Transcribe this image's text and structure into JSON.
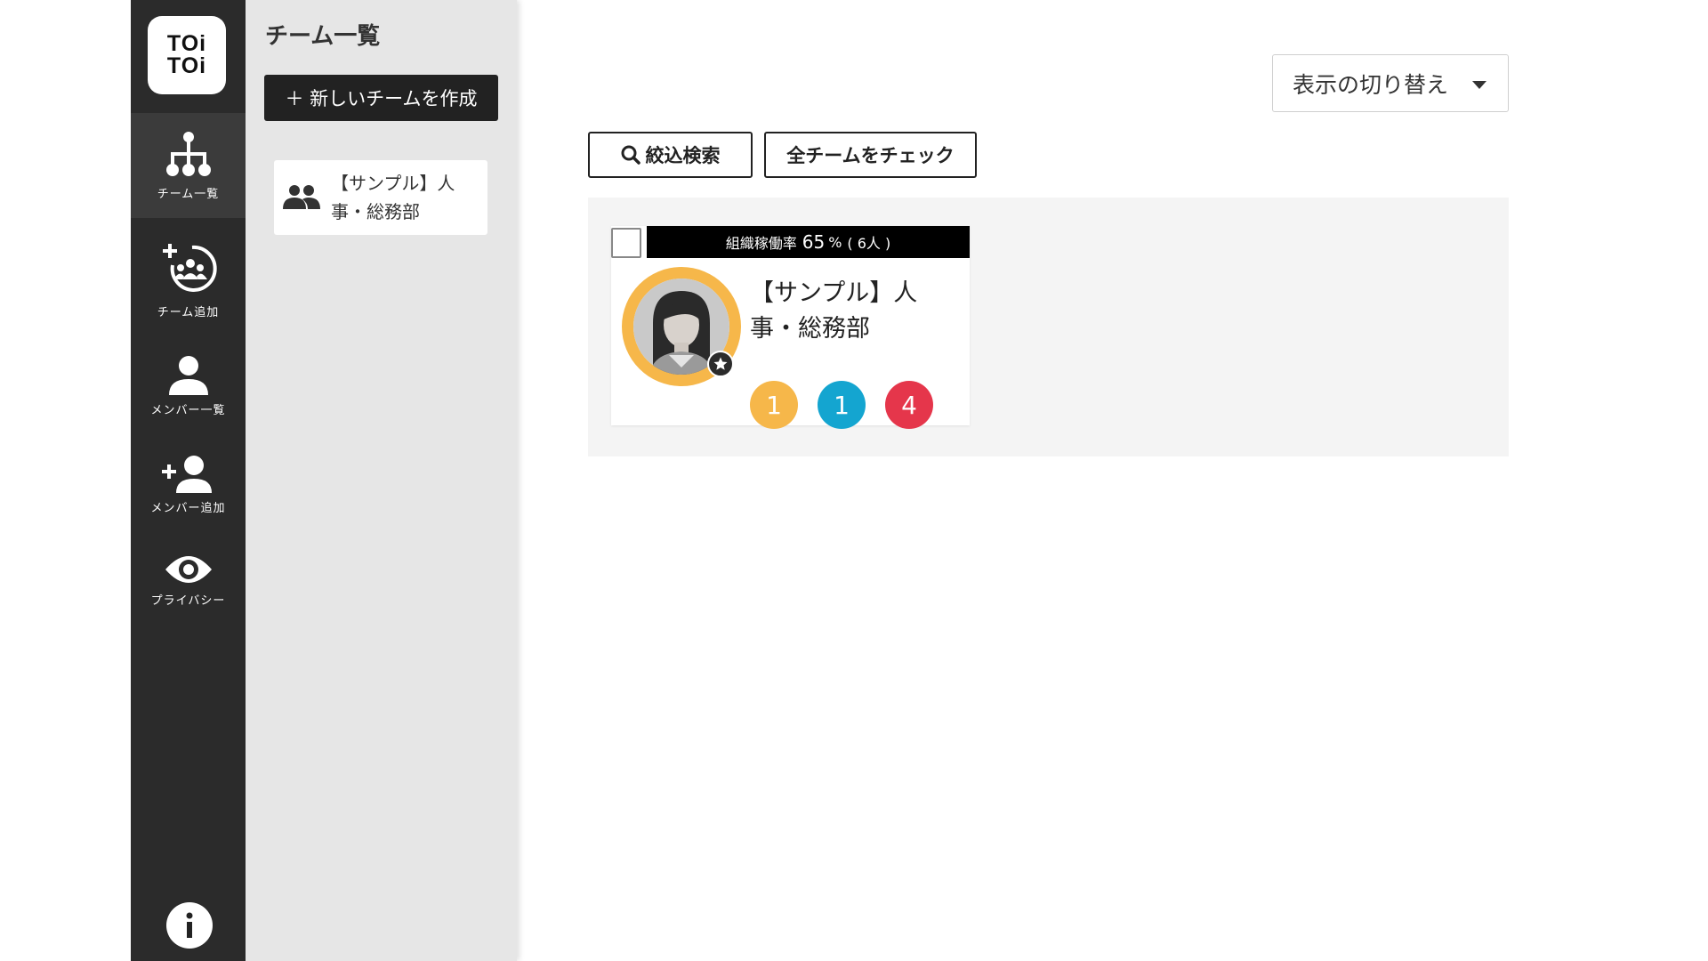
{
  "app": {
    "logo_line1": "TOi",
    "logo_line2": "TOi"
  },
  "rail": {
    "items": [
      {
        "label": "チーム一覧",
        "icon": "org-chart-icon"
      },
      {
        "label": "チーム追加",
        "icon": "add-team-icon"
      },
      {
        "label": "メンバー一覧",
        "icon": "person-icon"
      },
      {
        "label": "メンバー追加",
        "icon": "add-person-icon"
      },
      {
        "label": "プライバシー",
        "icon": "eye-icon"
      }
    ],
    "info_icon": "info-icon"
  },
  "panel": {
    "title": "チーム一覧",
    "new_team_label": "＋ 新しいチームを作成",
    "teams": [
      {
        "name": "【サンプル】人事・総務部",
        "icon": "people-icon"
      }
    ]
  },
  "main": {
    "view_toggle_label": "表示の切り替え",
    "search_label": "絞込検索",
    "check_all_label": "全チームをチェック",
    "card": {
      "rate_prefix": "組織稼働率",
      "rate_value": "65",
      "rate_suffix": "%",
      "member_count": "( 6人 )",
      "name": "【サンプル】人事・総務部",
      "counts": [
        {
          "value": "1",
          "color": "#f6b74a"
        },
        {
          "value": "1",
          "color": "#14a5d0"
        },
        {
          "value": "4",
          "color": "#e5364b"
        }
      ]
    }
  },
  "colors": {
    "rail_bg": "#2b2b2b",
    "panel_bg": "#e6e6e6",
    "accent_ring": "#f6b74a"
  }
}
